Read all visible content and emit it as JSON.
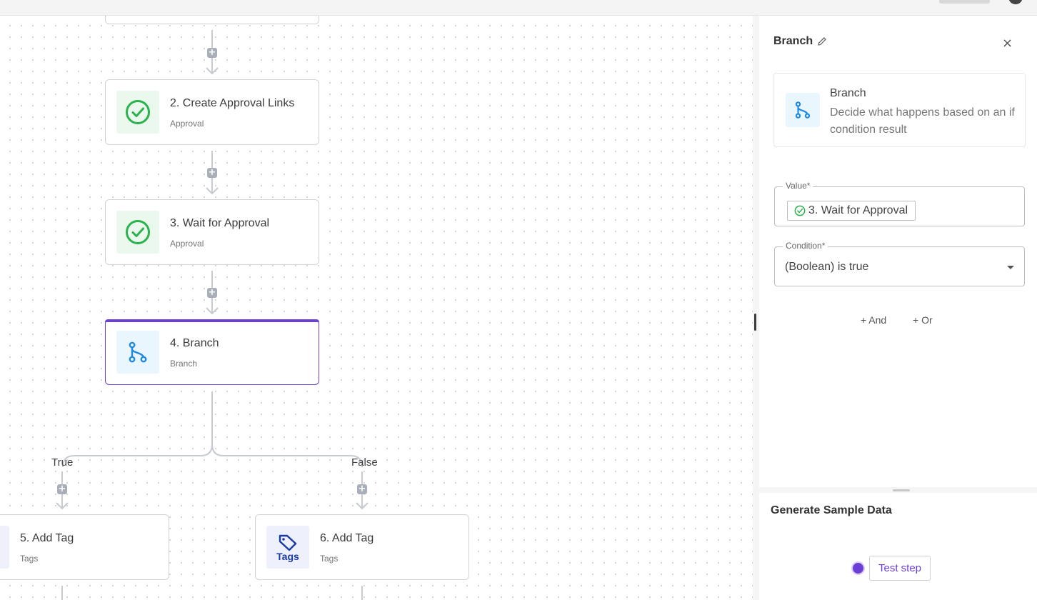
{
  "canvas": {
    "nodes": [
      {
        "title": "2. Create Approval Links",
        "subtitle": "Approval",
        "icon": "check-circle-icon"
      },
      {
        "title": "3. Wait for Approval",
        "subtitle": "Approval",
        "icon": "check-circle-icon"
      },
      {
        "title": "4. Branch",
        "subtitle": "Branch",
        "icon": "branch-icon",
        "selected": true
      },
      {
        "title": "5. Add Tag",
        "subtitle": "Tags",
        "icon": "tag-icon"
      },
      {
        "title": "6. Add Tag",
        "subtitle": "Tags",
        "icon": "tag-icon"
      }
    ],
    "branch_true": "True",
    "branch_false": "False",
    "plus_glyph": "+",
    "tags_icon_text": "Tags"
  },
  "panel": {
    "title": "Branch",
    "close_glyph": "×",
    "app": {
      "name": "Branch",
      "description": "Decide what happens based on an if condition result"
    },
    "value_field": {
      "label": "Value*",
      "chip": "3. Wait for Approval"
    },
    "condition_field": {
      "label": "Condition*",
      "value": "(Boolean) is true"
    },
    "and_label": "+ And",
    "or_label": "+ Or"
  },
  "sample": {
    "title": "Generate Sample Data",
    "test_button": "Test step"
  },
  "colors": {
    "accent": "#6b3fd6",
    "approval_green": "#2bb24c",
    "branch_blue": "#1e88e5",
    "tag_navy": "#1a3aa8"
  }
}
